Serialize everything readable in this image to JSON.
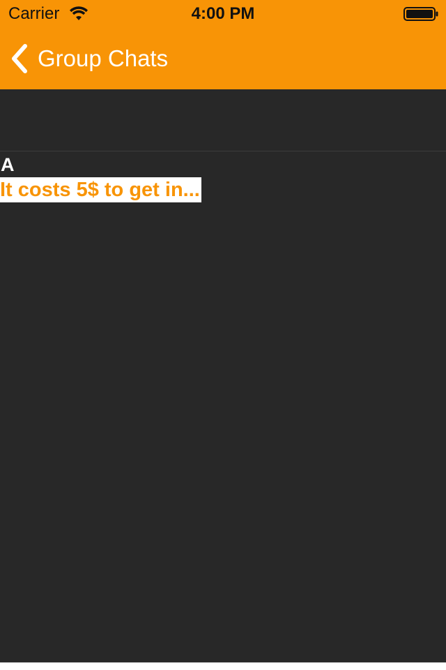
{
  "colors": {
    "accent": "#f89406",
    "background": "#282828",
    "nav_text": "#ffffff",
    "status_text": "#111111"
  },
  "status_bar": {
    "carrier": "Carrier",
    "time": "4:00 PM",
    "wifi_icon": "wifi-icon",
    "battery_icon": "battery-icon"
  },
  "nav": {
    "back_label": "Group Chats",
    "back_icon": "chevron-left-icon"
  },
  "messages": [
    {
      "sender": "A",
      "preview": "It costs 5$ to get in..."
    }
  ]
}
